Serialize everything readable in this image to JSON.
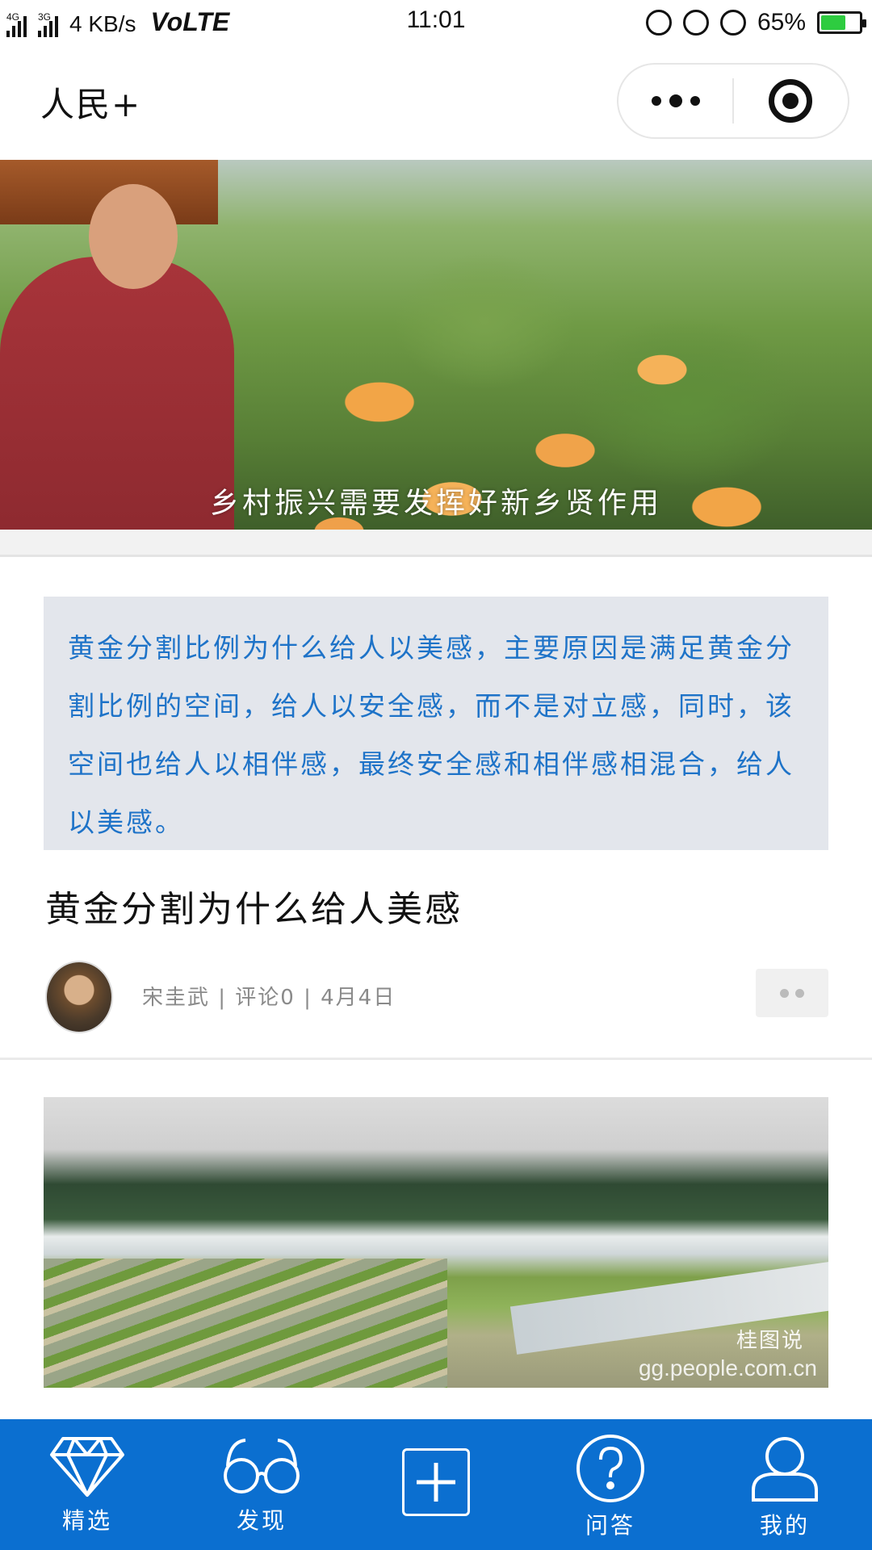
{
  "status_bar": {
    "net_tag_1": "4G",
    "net_tag_2": "3G",
    "speed": "4 KB/s",
    "volte": "VoLTE",
    "time": "11:01",
    "battery_percent_text": "65%",
    "battery_level": 0.65,
    "icons": [
      "vibrate-icon",
      "rotation-lock-icon",
      "alarm-icon",
      "battery-icon"
    ]
  },
  "header": {
    "title": "人民+",
    "capsule": {
      "more_icon": "more-dots-icon",
      "close_icon": "target-icon"
    }
  },
  "banner": {
    "caption": "乡村振兴需要发挥好新乡贤作用"
  },
  "article": {
    "quote": "黄金分割比例为什么给人以美感，主要原因是满足黄金分割比例的空间，给人以安全感，而不是对立感，同时，该空间也给人以相伴感，最终安全感和相伴感相混合，给人以美感。",
    "title": "黄金分割为什么给人美感",
    "meta": "宋圭武 | 评论0 | 4月4日",
    "more_icon": "more-dots-icon"
  },
  "next_article": {
    "watermark_logo": "桂图说",
    "watermark_url": "gg.people.com.cn"
  },
  "tabbar": {
    "colors": {
      "background": "#0b6fd0",
      "foreground": "#ffffff"
    },
    "items": [
      {
        "label": "精选",
        "icon": "diamond-icon"
      },
      {
        "label": "发现",
        "icon": "glasses-icon"
      },
      {
        "label": "",
        "icon": "plus-icon"
      },
      {
        "label": "问答",
        "icon": "question-icon"
      },
      {
        "label": "我的",
        "icon": "user-icon"
      }
    ]
  }
}
